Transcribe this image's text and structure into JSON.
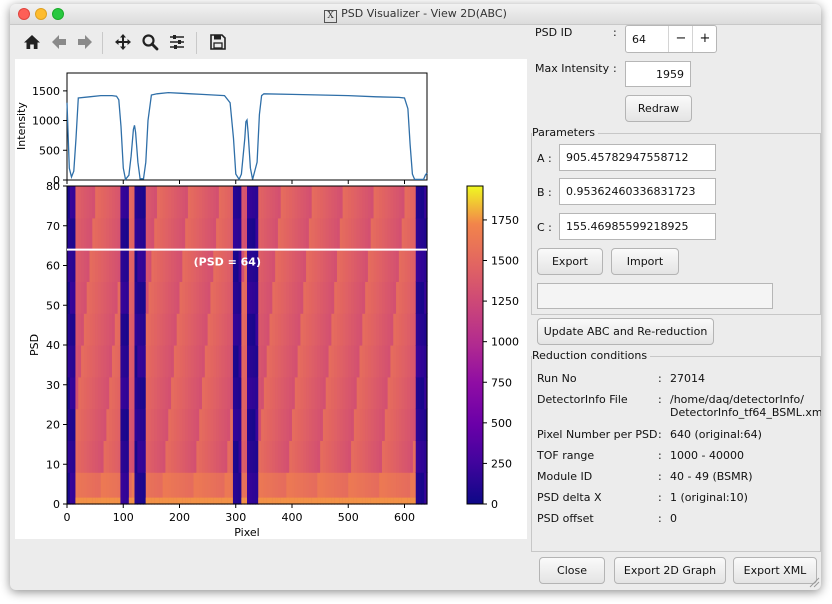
{
  "window": {
    "title": "PSD Visualizer - View 2D(ABC)",
    "title_icon": "X"
  },
  "toolbar": {
    "icons": [
      "home-icon",
      "back-arrow-icon",
      "forward-arrow-icon",
      "pan-icon",
      "zoom-icon",
      "configure-subplots-icon",
      "save-icon"
    ]
  },
  "psd_id": {
    "label": "PSD ID",
    "colon": ":",
    "value": "64",
    "minus": "−",
    "plus": "+"
  },
  "max_intensity": {
    "label": "Max Intensity",
    "colon": ":",
    "value": "1959"
  },
  "redraw_label": "Redraw",
  "parameters": {
    "title": "Parameters",
    "a_label": "A :",
    "a_value": "905.45782947558712",
    "b_label": "B :",
    "b_value": "0.95362460336831723",
    "c_label": "C :",
    "c_value": "155.46985599218925",
    "export_label": "Export",
    "import_label": "Import",
    "message": ""
  },
  "update_label": "Update ABC and Re-reduction",
  "reduction": {
    "title": "Reduction conditions",
    "rows": [
      {
        "label": "Run No",
        "colon": ":",
        "value": "27014",
        "value2": ""
      },
      {
        "label": "DetectorInfo File",
        "colon": ":",
        "value": "/home/daq/detectorInfo/",
        "value2": "DetectorInfo_tf64_BSML.xml"
      },
      {
        "label": "Pixel Number per PSD",
        "colon": ":",
        "value": "640 (original:64)",
        "value2": ""
      },
      {
        "label": "TOF range",
        "colon": ":",
        "value": "1000 - 40000",
        "value2": ""
      },
      {
        "label": "Module ID",
        "colon": ":",
        "value": "40 - 49 (BSMR)",
        "value2": ""
      },
      {
        "label": "PSD delta X",
        "colon": ":",
        "value": "1 (original:10)",
        "value2": ""
      },
      {
        "label": "PSD offset",
        "colon": ":",
        "value": "0",
        "value2": ""
      }
    ]
  },
  "bottom_buttons": {
    "close": "Close",
    "export_2d": "Export 2D Graph",
    "export_xml": "Export XML"
  },
  "chart_data": [
    {
      "type": "line",
      "ylabel": "Intensity",
      "xlim": [
        0,
        640
      ],
      "ylim": [
        0,
        1800
      ],
      "yticks": [
        "0",
        "500",
        "1000",
        "1500"
      ],
      "series": [
        {
          "x": [
            0,
            4,
            8,
            12,
            16,
            20,
            40,
            60,
            80,
            88,
            92,
            96,
            100,
            104,
            110,
            114,
            118,
            120,
            122,
            126,
            130,
            136,
            140,
            144,
            150,
            160,
            180,
            200,
            220,
            240,
            260,
            280,
            290,
            296,
            300,
            306,
            310,
            316,
            318,
            320,
            322,
            326,
            330,
            338,
            342,
            346,
            350,
            400,
            450,
            500,
            550,
            590,
            600,
            606,
            610,
            614,
            618,
            622,
            626,
            630,
            634,
            637,
            640
          ],
          "y": [
            1300,
            200,
            50,
            150,
            700,
            1380,
            1400,
            1420,
            1420,
            1410,
            1350,
            900,
            200,
            10,
            80,
            400,
            850,
            920,
            800,
            300,
            20,
            20,
            300,
            1000,
            1430,
            1450,
            1470,
            1460,
            1450,
            1440,
            1430,
            1420,
            1300,
            700,
            100,
            10,
            100,
            700,
            980,
            1010,
            800,
            200,
            10,
            300,
            1100,
            1420,
            1450,
            1440,
            1430,
            1420,
            1400,
            1390,
            1380,
            1200,
            600,
            100,
            10,
            10,
            10,
            10,
            10,
            80,
            120
          ],
          "color": "#2f6fa8"
        }
      ]
    },
    {
      "type": "heatmap",
      "xlabel": "Pixel",
      "ylabel": "PSD",
      "xlim": [
        0,
        640
      ],
      "ylim": [
        0,
        80
      ],
      "xticks": [
        "0",
        "100",
        "200",
        "300",
        "400",
        "500",
        "600"
      ],
      "yticks": [
        "0",
        "10",
        "20",
        "30",
        "40",
        "50",
        "60",
        "70",
        "80"
      ],
      "colorbar": {
        "min": 0,
        "max": 1959,
        "ticks": [
          "0",
          "250",
          "500",
          "750",
          "1000",
          "1250",
          "1500",
          "1750"
        ],
        "colormap": "plasma"
      },
      "dark_bands": [
        [
          0,
          15
        ],
        [
          95,
          110
        ],
        [
          118,
          140
        ],
        [
          295,
          310
        ],
        [
          320,
          340
        ],
        [
          618,
          640
        ]
      ],
      "base_intensity": 1420,
      "bright_bottom_intensity": 1750,
      "marker_line": {
        "psd": 64,
        "label": "(PSD = 64)",
        "color": "#ffffff"
      }
    }
  ]
}
